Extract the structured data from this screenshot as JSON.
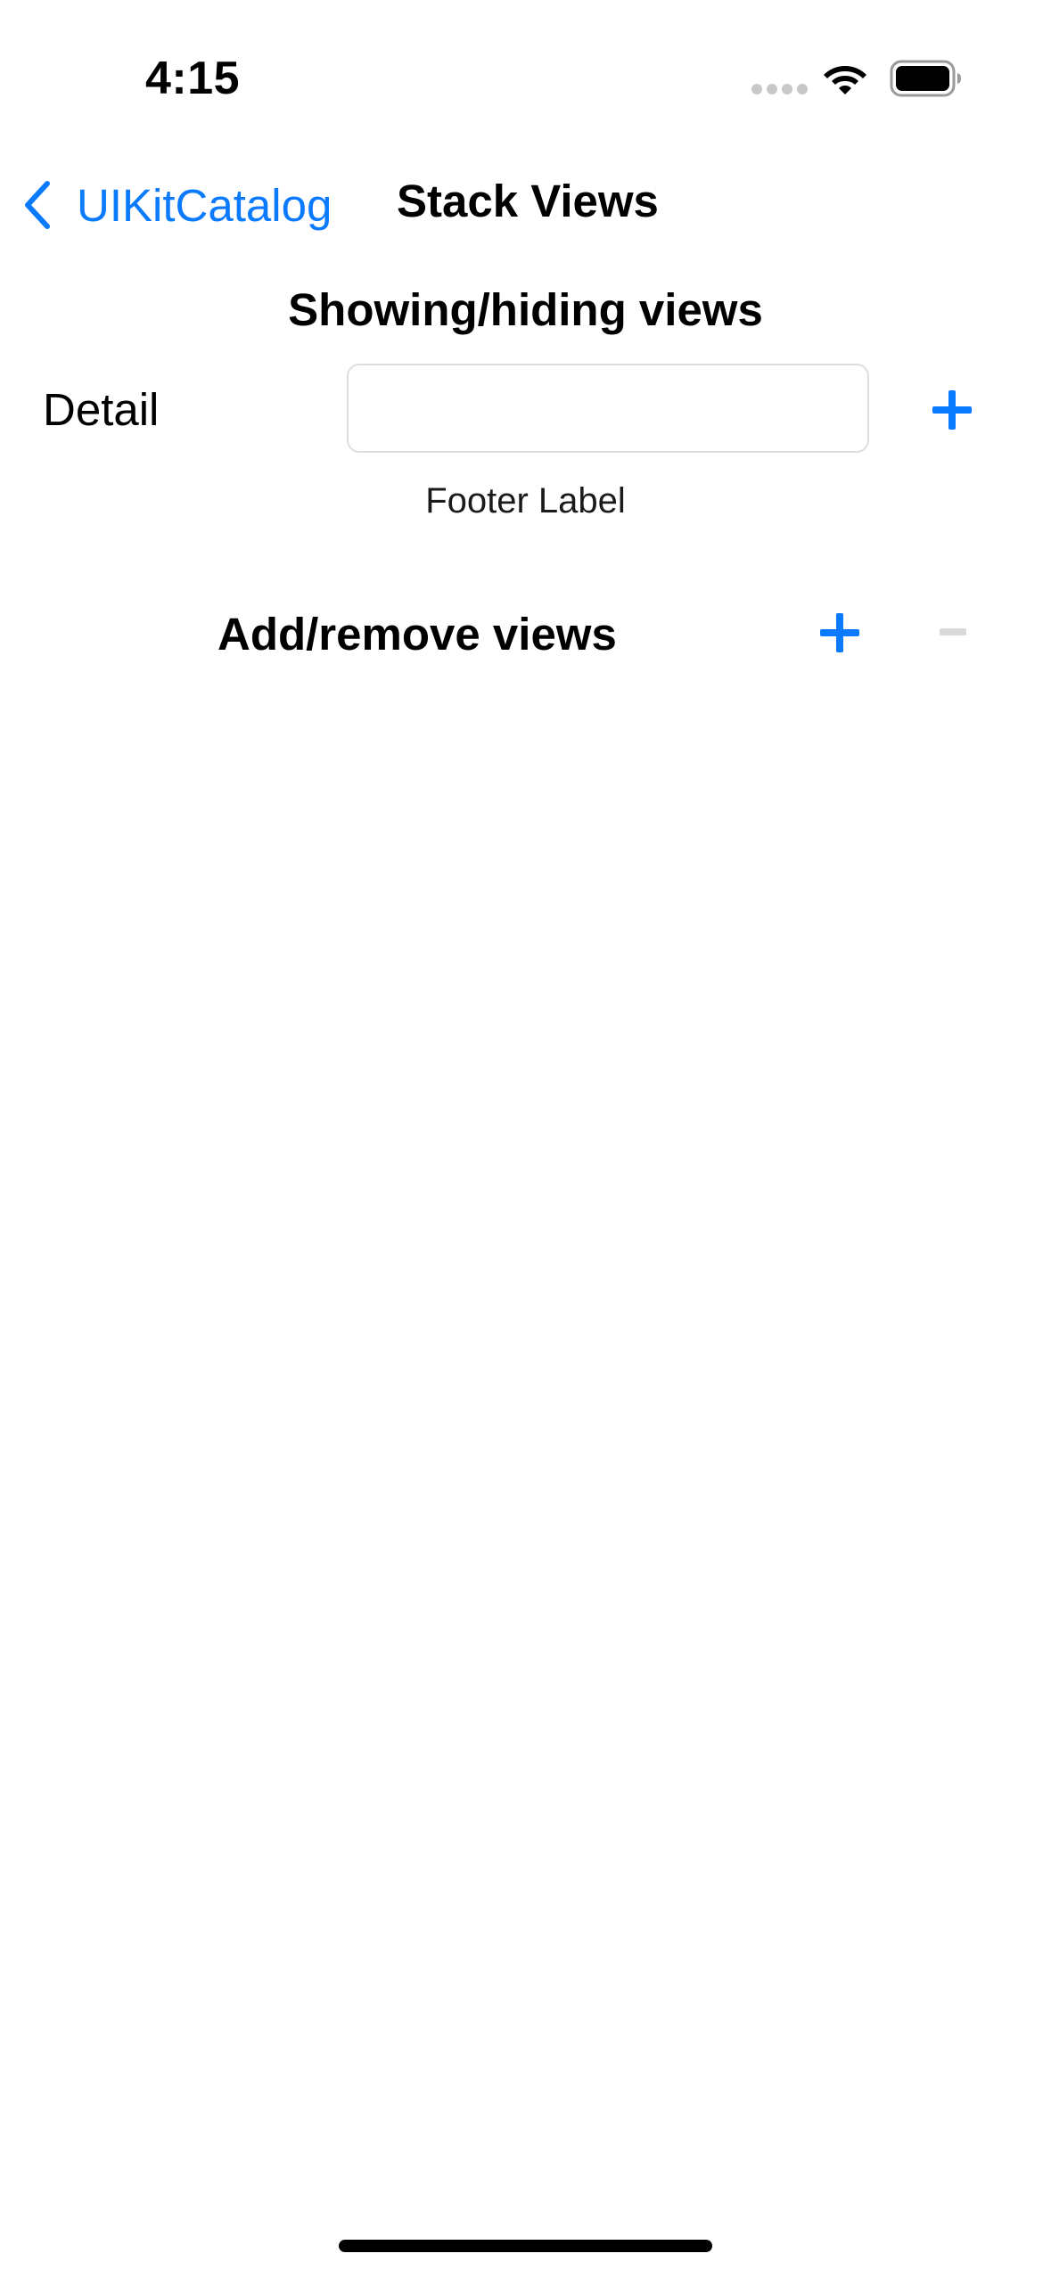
{
  "status_bar": {
    "time": "4:15",
    "icons": [
      "cellular-signal-icon",
      "wifi-icon",
      "battery-icon"
    ]
  },
  "nav_bar": {
    "back_label": "UIKitCatalog",
    "back_icon": "chevron-left-icon",
    "title": "Stack Views"
  },
  "showing_hiding": {
    "title": "Showing/hiding views",
    "detail_label": "Detail",
    "detail_field_value": "",
    "add_icon": "plus-icon",
    "footer_label": "Footer Label"
  },
  "add_remove": {
    "title": "Add/remove views",
    "add_icon": "plus-icon",
    "remove_icon": "minus-icon",
    "remove_enabled": false
  },
  "colors": {
    "accent": "#0a7aff",
    "disabled": "#d9d9d9",
    "text": "#000000",
    "background": "#ffffff"
  }
}
